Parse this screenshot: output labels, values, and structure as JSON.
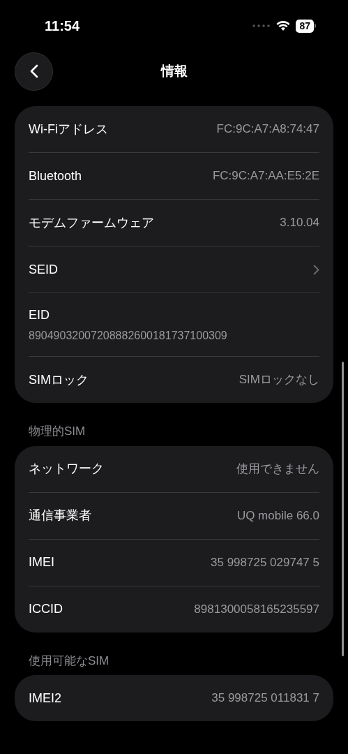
{
  "status_bar": {
    "time": "11:54",
    "battery": "87"
  },
  "nav": {
    "title": "情報"
  },
  "sections": [
    {
      "rows": [
        {
          "kind": "value",
          "label": "Wi-Fiアドレス",
          "value": "FC:9C:A7:A8:74:47"
        },
        {
          "kind": "value",
          "label": "Bluetooth",
          "value": "FC:9C:A7:AA:E5:2E"
        },
        {
          "kind": "value",
          "label": "モデムファームウェア",
          "value": "3.10.04"
        },
        {
          "kind": "chevron",
          "label": "SEID"
        },
        {
          "kind": "stacked",
          "label": "EID",
          "value": "89049032007208882600181737100309"
        },
        {
          "kind": "value",
          "label": "SIMロック",
          "value": "SIMロックなし"
        }
      ]
    },
    {
      "header": "物理的SIM",
      "rows": [
        {
          "kind": "value",
          "label": "ネットワーク",
          "value": "使用できません"
        },
        {
          "kind": "value",
          "label": "通信事業者",
          "value": "UQ mobile 66.0"
        },
        {
          "kind": "value",
          "label": "IMEI",
          "value": "35 998725 029747 5"
        },
        {
          "kind": "value",
          "label": "ICCID",
          "value": "8981300058165235597"
        }
      ]
    },
    {
      "header": "使用可能なSIM",
      "rows": [
        {
          "kind": "value",
          "label": "IMEI2",
          "value": "35 998725 011831 7"
        }
      ]
    }
  ]
}
